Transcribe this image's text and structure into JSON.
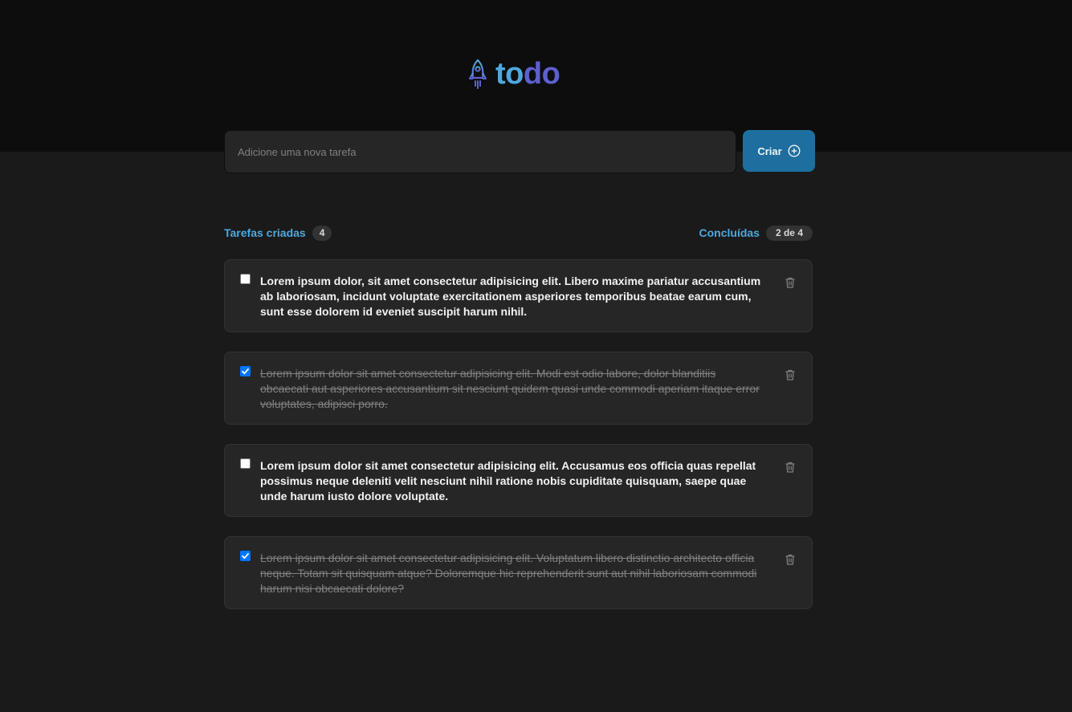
{
  "app": {
    "logo_part1": "to",
    "logo_part2": "do",
    "brand_colors": {
      "primary": "#4ea8de",
      "secondary": "#5e60ce",
      "button": "#1e6f9f"
    }
  },
  "new_task": {
    "placeholder": "Adicione uma nova tarefa",
    "value": "",
    "create_label": "Criar"
  },
  "summary": {
    "created_label": "Tarefas criadas",
    "created_count": "4",
    "done_label": "Concluídas",
    "done_count": "2 de 4"
  },
  "tasks": [
    {
      "text": "Lorem ipsum dolor, sit amet consectetur adipisicing elit. Libero maxime pariatur accusantium ab laboriosam, incidunt voluptate exercitationem asperiores temporibus beatae earum cum, sunt esse dolorem id eveniet suscipit harum nihil.",
      "done": false
    },
    {
      "text": "Lorem ipsum dolor sit amet consectetur adipisicing elit. Modi est odio labore, dolor blanditiis obcaecati aut asperiores accusantium sit nesciunt quidem quasi unde commodi aperiam itaque error voluptates, adipisci porro.",
      "done": true
    },
    {
      "text": "Lorem ipsum dolor sit amet consectetur adipisicing elit. Accusamus eos officia quas repellat possimus neque deleniti velit nesciunt nihil ratione nobis cupiditate quisquam, saepe quae unde harum iusto dolore voluptate.",
      "done": false
    },
    {
      "text": "Lorem ipsum dolor sit amet consectetur adipisicing elit. Voluptatum libero distinctio architecto officia neque. Totam sit quisquam atque? Doloremque hic reprehenderit sunt aut nihil laboriosam commodi harum nisi obcaecati dolore?",
      "done": true
    }
  ],
  "icons": {
    "logo": "rocket-icon",
    "create": "plus-circle-icon",
    "delete": "trash-icon",
    "checkbox": "checkbox-icon"
  }
}
